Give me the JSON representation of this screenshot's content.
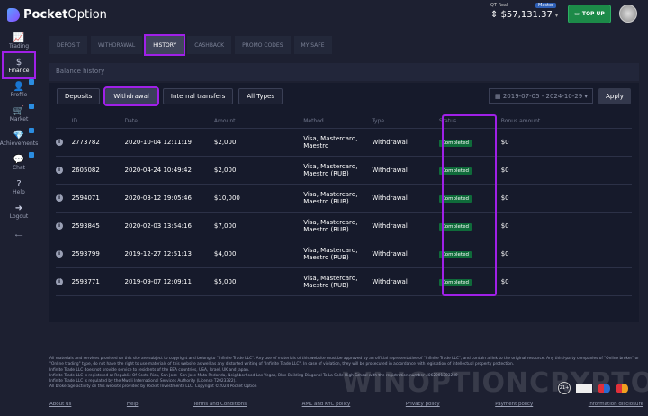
{
  "header": {
    "brand_bold": "Pocket",
    "brand_light": "Option",
    "account_label": "QT Real",
    "account_badge": "Master",
    "balance": "$57,131.37",
    "topup": "TOP UP"
  },
  "sidebar": [
    {
      "label": "Trading",
      "icon": "📈"
    },
    {
      "label": "Finance",
      "icon": "$"
    },
    {
      "label": "Profile",
      "icon": "👤"
    },
    {
      "label": "Market",
      "icon": "🛒"
    },
    {
      "label": "Achievements",
      "icon": "💎"
    },
    {
      "label": "Chat",
      "icon": "💬"
    },
    {
      "label": "Help",
      "icon": "?"
    },
    {
      "label": "Logout",
      "icon": "➜"
    }
  ],
  "tabs": [
    "Deposit",
    "Withdrawal",
    "History",
    "Cashback",
    "Promo codes",
    "My safe"
  ],
  "section_title": "Balance history",
  "filters": [
    "Deposits",
    "Withdrawal",
    "Internal transfers",
    "All Types"
  ],
  "date_range": "2019-07-05 - 2024-10-29",
  "apply": "Apply",
  "columns": [
    "ID",
    "Date",
    "Amount",
    "Method",
    "Type",
    "Status",
    "Bonus amount"
  ],
  "rows": [
    {
      "id": "2773782",
      "date": "2020-10-04 12:11:19",
      "amount": "$2,000",
      "method": "Visa, Mastercard, Maestro",
      "type": "Withdrawal",
      "status": "Completed",
      "bonus": "$0"
    },
    {
      "id": "2605082",
      "date": "2020-04-24 10:49:42",
      "amount": "$2,000",
      "method": "Visa, Mastercard, Maestro (RUB)",
      "type": "Withdrawal",
      "status": "Completed",
      "bonus": "$0"
    },
    {
      "id": "2594071",
      "date": "2020-03-12 19:05:46",
      "amount": "$10,000",
      "method": "Visa, Mastercard, Maestro (RUB)",
      "type": "Withdrawal",
      "status": "Completed",
      "bonus": "$0"
    },
    {
      "id": "2593845",
      "date": "2020-02-03 13:54:16",
      "amount": "$7,000",
      "method": "Visa, Mastercard, Maestro (RUB)",
      "type": "Withdrawal",
      "status": "Completed",
      "bonus": "$0"
    },
    {
      "id": "2593799",
      "date": "2019-12-27 12:51:13",
      "amount": "$4,000",
      "method": "Visa, Mastercard, Maestro (RUB)",
      "type": "Withdrawal",
      "status": "Completed",
      "bonus": "$0"
    },
    {
      "id": "2593771",
      "date": "2019-09-07 12:09:11",
      "amount": "$5,000",
      "method": "Visa, Mastercard, Maestro (RUB)",
      "type": "Withdrawal",
      "status": "Completed",
      "bonus": "$0"
    }
  ],
  "legal": [
    "All materials and services provided on this site are subject to copyright and belong to \"Infinite Trade LLC\". Any use of materials of this website must be approved by an official representative of \"Infinite Trade LLC\", and contain a link to the original resource. Any third-party companies of \"Online broker\" or \"Online trading\" type, do not have the right to use materials of this website as well as any distorted writing of \"Infinite Trade LLC\". In case of violation, they will be prosecuted in accordance with legislation of intellectual property protection.",
    "Infinite Trade LLC does not provide service to residents of the EEA countries, USA, Israel, UK and Japan.",
    "Infinite Trade LLC is registered at Republic Of Costa Rica, San Jose- San Jose Mata Redonda, Neighborhood Las Vegas, Blue Building Diagonal To La Salle High School with the registration number 4062001303240",
    "Infinite Trade LLC is regulated by the Mwali International Services Authority (License T2023322).",
    "All brokerage activity on this website provided by Pocket Investments LLC. Copyright ©2024 Pocket Option"
  ],
  "footer_links": [
    "About us",
    "Help",
    "Terms and Conditions",
    "AML and KYC policy",
    "Privacy policy",
    "Payment policy",
    "Information disclosure"
  ],
  "age_badge": "21+",
  "watermark": "WINOPTIONCRYPTO.COM",
  "colors": {
    "highlight": "#a020e8",
    "completed": "#0f6b3a",
    "topup": "#1c8a48"
  }
}
